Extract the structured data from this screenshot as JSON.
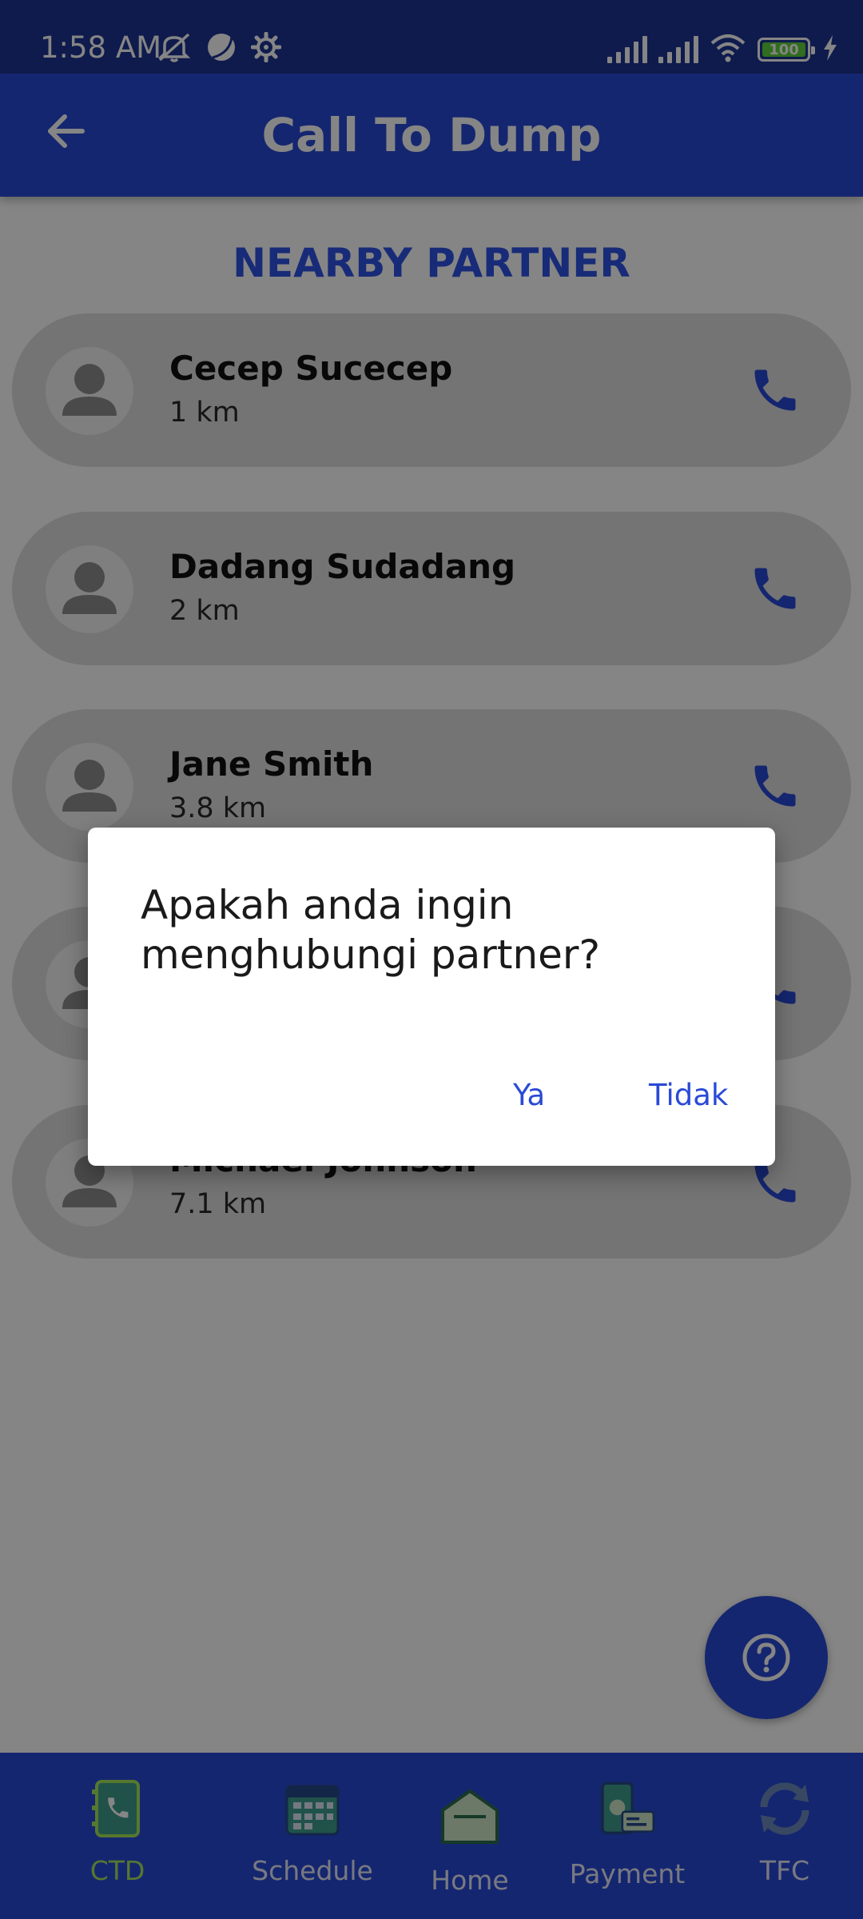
{
  "status_bar": {
    "time": "1:58 AM",
    "battery_level": "100",
    "icons_left": [
      "mute-icon",
      "moon-icon",
      "gear-icon"
    ],
    "icons_right": [
      "signal-icon",
      "signal-icon",
      "wifi-icon",
      "battery-icon",
      "charging-icon"
    ]
  },
  "app_bar": {
    "title": "Call To Dump",
    "back_icon": "back-arrow-icon"
  },
  "section_title": "NEARBY PARTNER",
  "partners": [
    {
      "name": "Cecep Sucecep",
      "distance": "1 km"
    },
    {
      "name": "Dadang Sudadang",
      "distance": "2 km"
    },
    {
      "name": "Jane Smith",
      "distance": "3.8 km"
    },
    {
      "name": "",
      "distance": ""
    },
    {
      "name": "Michael Johnson",
      "distance": "7.1 km"
    }
  ],
  "fab": {
    "icon": "help-icon"
  },
  "bottom_nav": [
    {
      "label": "CTD",
      "icon": "call-book-icon",
      "active": true
    },
    {
      "label": "Schedule",
      "icon": "calendar-icon",
      "active": false
    },
    {
      "label": "Home",
      "icon": "home-icon",
      "active": false
    },
    {
      "label": "Payment",
      "icon": "payment-icon",
      "active": false
    },
    {
      "label": "TFC",
      "icon": "refresh-icon",
      "active": false
    }
  ],
  "dialog": {
    "message": "Apakah anda ingin menghubungi partner?",
    "confirm_label": "Ya",
    "cancel_label": "Tidak"
  },
  "colors": {
    "primary": "#2a4ad6",
    "accent_active": "#a6e55a",
    "card": "#dedede",
    "scrim": "rgba(0,0,0,0.48)"
  }
}
